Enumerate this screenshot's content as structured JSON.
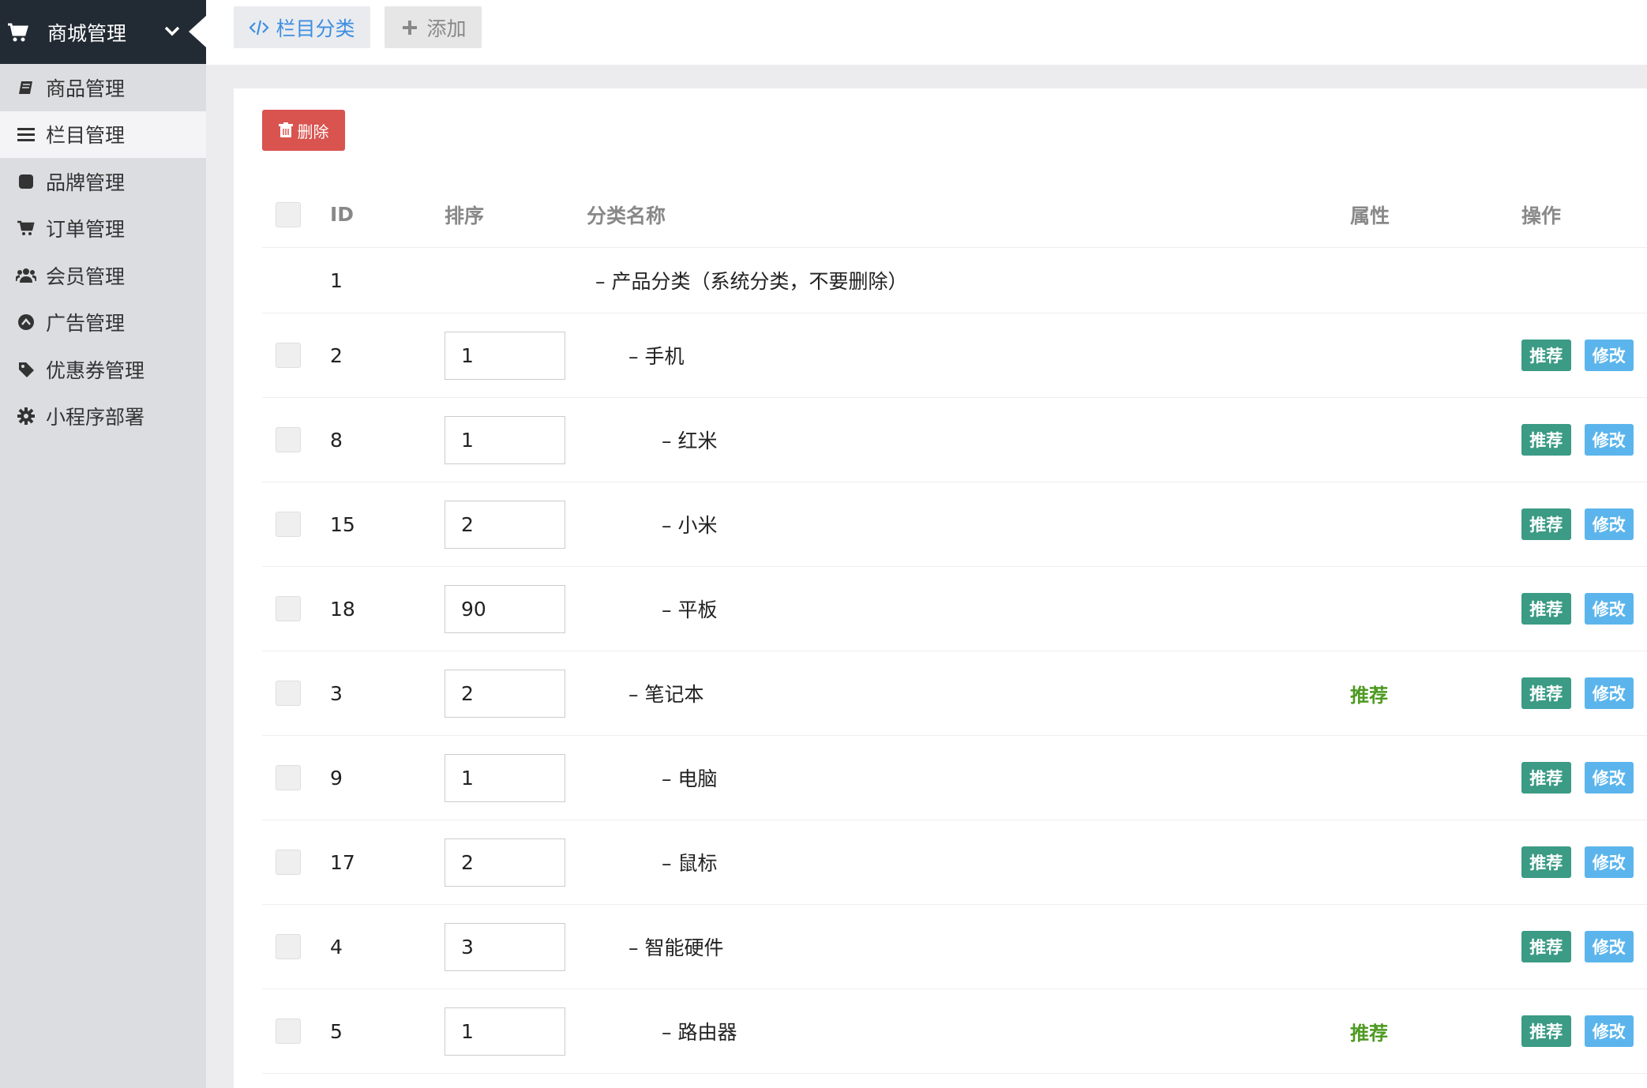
{
  "sidebar": {
    "header_title": "商城管理",
    "items": [
      {
        "label": "商品管理",
        "icon": "book-icon",
        "active": false
      },
      {
        "label": "栏目管理",
        "icon": "list-icon",
        "active": true
      },
      {
        "label": "品牌管理",
        "icon": "square-icon",
        "active": false
      },
      {
        "label": "订单管理",
        "icon": "cart-icon",
        "active": false
      },
      {
        "label": "会员管理",
        "icon": "users-icon",
        "active": false
      },
      {
        "label": "广告管理",
        "icon": "arrow-circle-icon",
        "active": false
      },
      {
        "label": "优惠券管理",
        "icon": "tag-icon",
        "active": false
      },
      {
        "label": "小程序部署",
        "icon": "gear-icon",
        "active": false
      }
    ]
  },
  "topbar": {
    "tab_category": "栏目分类",
    "tab_add": "添加"
  },
  "toolbar": {
    "delete_label": "删除"
  },
  "table": {
    "headers": {
      "id": "ID",
      "sort": "排序",
      "name": "分类名称",
      "attr": "属性",
      "ops": "操作"
    },
    "root": {
      "id": "1",
      "name": "– 产品分类（系统分类，不要删除）"
    },
    "rows": [
      {
        "id": "2",
        "sort": "1",
        "name": "– 手机",
        "level": 1,
        "attr": ""
      },
      {
        "id": "8",
        "sort": "1",
        "name": "– 红米",
        "level": 2,
        "attr": ""
      },
      {
        "id": "15",
        "sort": "2",
        "name": "– 小米",
        "level": 2,
        "attr": ""
      },
      {
        "id": "18",
        "sort": "90",
        "name": "– 平板",
        "level": 2,
        "attr": ""
      },
      {
        "id": "3",
        "sort": "2",
        "name": "– 笔记本",
        "level": 1,
        "attr": "推荐"
      },
      {
        "id": "9",
        "sort": "1",
        "name": "– 电脑",
        "level": 2,
        "attr": ""
      },
      {
        "id": "17",
        "sort": "2",
        "name": "– 鼠标",
        "level": 2,
        "attr": ""
      },
      {
        "id": "4",
        "sort": "3",
        "name": "– 智能硬件",
        "level": 1,
        "attr": ""
      },
      {
        "id": "5",
        "sort": "1",
        "name": "– 路由器",
        "level": 2,
        "attr": "推荐"
      }
    ],
    "op_recommend": "推荐",
    "op_edit": "修改"
  }
}
